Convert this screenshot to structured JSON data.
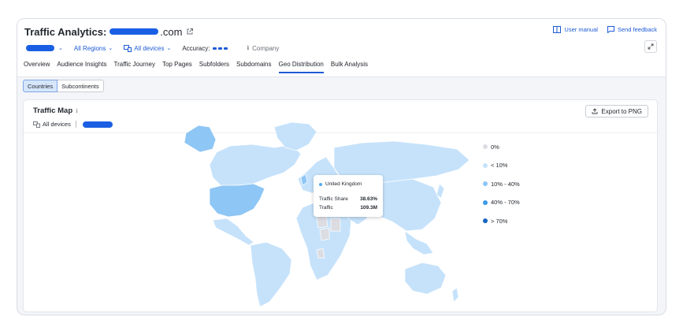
{
  "header": {
    "title_prefix": "Traffic Analytics:",
    "title_suffix": ".com",
    "user_manual": "User manual",
    "send_feedback": "Send feedback"
  },
  "filters": {
    "regions": "All Regions",
    "devices": "All devices",
    "accuracy_label": "Accuracy:",
    "company": "Company"
  },
  "tabs": [
    {
      "label": "Overview",
      "active": false
    },
    {
      "label": "Audience Insights",
      "active": false
    },
    {
      "label": "Traffic Journey",
      "active": false
    },
    {
      "label": "Top Pages",
      "active": false
    },
    {
      "label": "Subfolders",
      "active": false
    },
    {
      "label": "Subdomains",
      "active": false
    },
    {
      "label": "Geo Distribution",
      "active": true
    },
    {
      "label": "Bulk Analysis",
      "active": false
    }
  ],
  "segment": {
    "countries": "Countries",
    "subcontinents": "Subcontinents",
    "selected": "Countries"
  },
  "map_card": {
    "title": "Traffic Map",
    "devices": "All devices",
    "export": "Export to PNG"
  },
  "legend": [
    {
      "label": "0%",
      "color": "#dcdde3"
    },
    {
      "label": "< 10%",
      "color": "#c6e2fb"
    },
    {
      "label": "10% - 40%",
      "color": "#8ec6f5"
    },
    {
      "label": "40% - 70%",
      "color": "#3d9be8"
    },
    {
      "label": "> 70%",
      "color": "#1565c0"
    }
  ],
  "tooltip": {
    "country": "United Kingdom",
    "share_label": "Traffic Share",
    "share_value": "38.63%",
    "traffic_label": "Traffic",
    "traffic_value": "109.3M"
  },
  "colors": {
    "accent": "#1d5bd6",
    "redaction": "#1a5fe3"
  }
}
